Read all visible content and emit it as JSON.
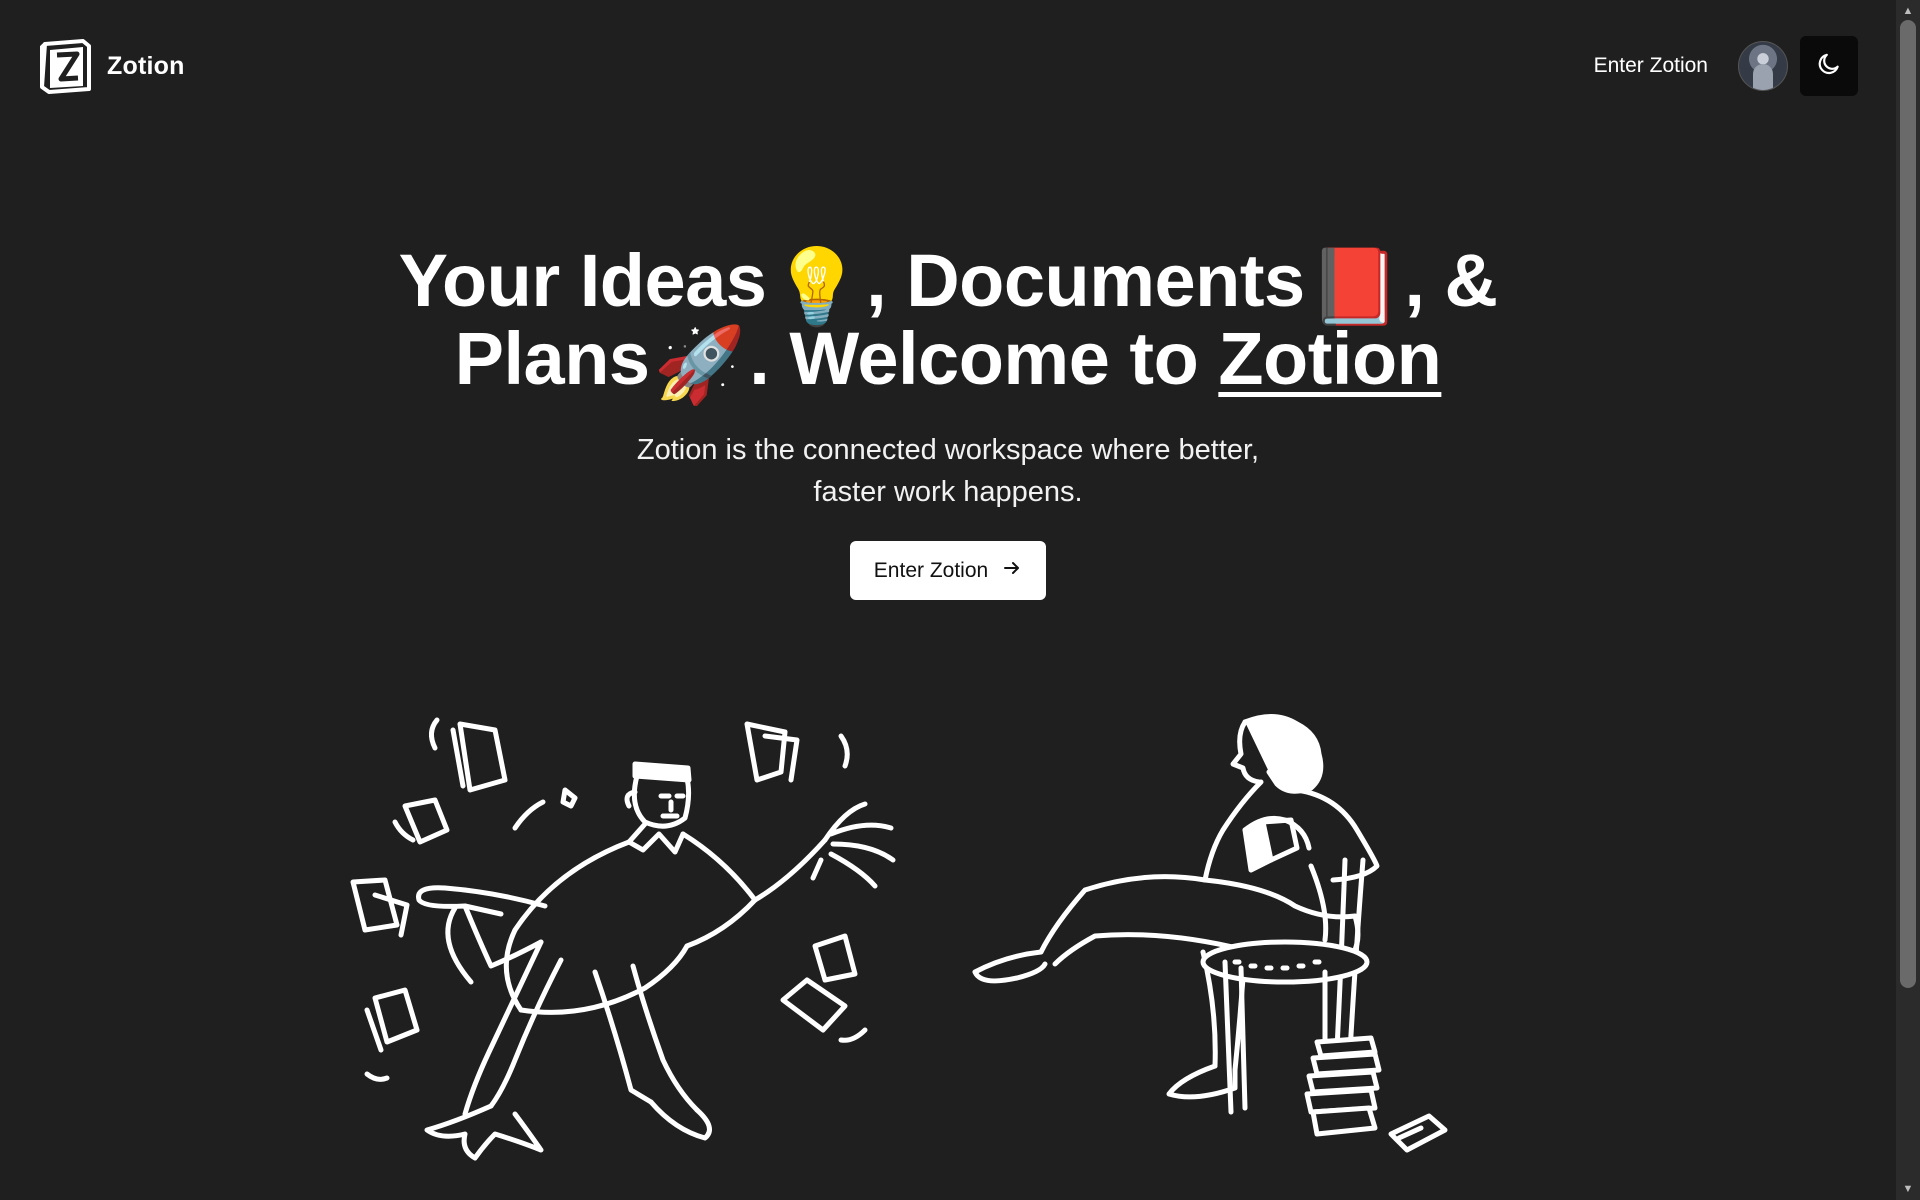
{
  "header": {
    "brand_name": "Zotion",
    "logo_icon": "zotion-logo-icon",
    "nav_link": "Enter Zotion",
    "avatar_icon": "user-avatar",
    "theme_toggle_icon": "moon-icon"
  },
  "hero": {
    "title_part1": "Your Ideas",
    "emoji_idea": "💡",
    "title_part2": ", Documents",
    "emoji_docs": "📕",
    "title_part3": ", & Plans",
    "emoji_plans": "🚀",
    "title_part4": ". Welcome to",
    "title_brand": "Zotion",
    "subtitle": "Zotion is the connected workspace where better, faster work happens.",
    "cta_label": "Enter Zotion",
    "cta_icon": "arrow-right-icon"
  },
  "illustrations": {
    "left": "person-juggling-papers-illustration",
    "right": "person-reading-in-chair-illustration"
  },
  "colors": {
    "background": "#1f1f1f",
    "text": "#ffffff",
    "button_bg": "#ffffff",
    "toggle_bg": "#0a0a0a"
  }
}
